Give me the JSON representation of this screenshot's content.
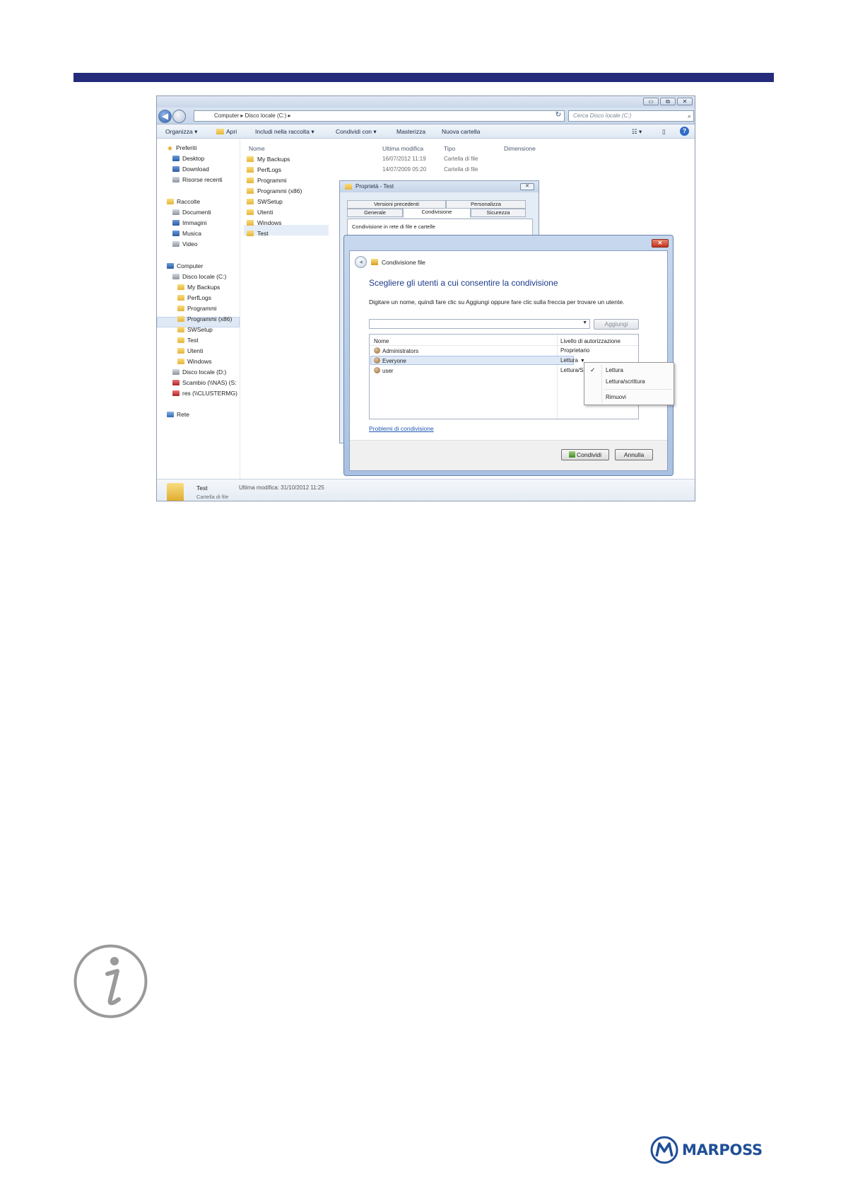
{
  "explorer": {
    "window_controls": [
      "▭",
      "⧉",
      "✕"
    ],
    "breadcrumb": [
      "Computer",
      "Disco locale (C:)"
    ],
    "search_placeholder": "Cerca Disco locale (C:)",
    "commands": {
      "organize": "Organizza ▾",
      "open": "Apri",
      "include": "Includi nella raccolta ▾",
      "share_with": "Condividi con ▾",
      "burn": "Masterizza",
      "new_folder": "Nuova cartella"
    },
    "nav": {
      "favorites": "Preferiti",
      "desktop": "Desktop",
      "download": "Download",
      "recent": "Risorse recenti",
      "libraries": "Raccolte",
      "documents": "Documenti",
      "pictures": "Immagini",
      "music": "Musica",
      "video": "Video",
      "computer": "Computer",
      "drive_c": "Disco locale (C:)",
      "c_folders": [
        "My Backups",
        "PerfLogs",
        "Programmi",
        "Programmi (x86)",
        "SWSetup",
        "Test",
        "Utenti",
        "Windows"
      ],
      "drive_d": "Disco locale (D:)",
      "nas": "Scambio (\\\\NAS) (S:",
      "cluster": "res (\\\\CLUSTERMG)",
      "network": "Rete"
    },
    "columns": {
      "name": "Nome",
      "modified": "Ultima modifica",
      "type": "Tipo",
      "size": "Dimensione"
    },
    "files": [
      {
        "name": "My Backups",
        "modified": "16/07/2012 11:19",
        "type": "Cartella di file"
      },
      {
        "name": "PerfLogs",
        "modified": "14/07/2009 05:20",
        "type": "Cartella di file"
      },
      {
        "name": "Programmi"
      },
      {
        "name": "Programmi (x86)"
      },
      {
        "name": "SWSetup"
      },
      {
        "name": "Utenti"
      },
      {
        "name": "Windows"
      },
      {
        "name": "Test"
      }
    ],
    "status": {
      "name": "Test",
      "modified": "Ultima modifica: 31/10/2012 11:25",
      "type": "Cartella di file"
    }
  },
  "properties": {
    "title": "Proprietà - Test",
    "close": "✕",
    "tabs": {
      "previous_versions": "Versioni precedenti",
      "customize": "Personalizza",
      "general": "Generale",
      "sharing": "Condivisione",
      "security": "Sicurezza"
    },
    "group_label": "Condivisione in rete di file e cartelle"
  },
  "sharing": {
    "title": "Condivisione file",
    "close": "✕",
    "heading": "Scegliere gli utenti a cui consentire la condivisione",
    "description": "Digitare un nome, quindi fare clic su Aggiungi oppure fare clic sulla freccia per trovare un utente.",
    "combo_value": "",
    "add_button": "Aggiungi",
    "columns": {
      "name": "Nome",
      "level": "Livello di autorizzazione"
    },
    "rows": [
      {
        "name": "Administrators",
        "level": "Proprietario"
      },
      {
        "name": "Everyone",
        "level": "Lettura"
      },
      {
        "name": "user",
        "level": "Lettura/Sc"
      }
    ],
    "problems_link": "Problemi di condivisione",
    "share_button": "Condividi",
    "cancel_button": "Annulla"
  },
  "permission_menu": {
    "items": [
      "Lettura",
      "Lettura/scrittura",
      "Rimuovi"
    ],
    "checked": "Lettura"
  },
  "brand": {
    "logo_text": "MARPOSS",
    "accent": "#232b7a",
    "logo_color": "#1f4e97"
  }
}
